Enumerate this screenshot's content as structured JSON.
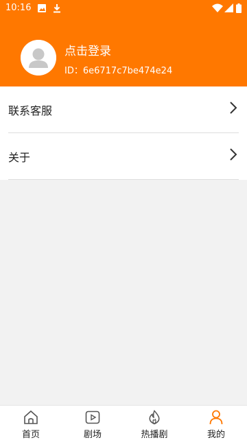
{
  "status_bar": {
    "time": "10:16",
    "icons": [
      "image-icon",
      "download-icon",
      "wifi-icon",
      "signal-icon",
      "battery-icon"
    ]
  },
  "profile": {
    "login_text": "点击登录",
    "user_id": "ID：6e6717c7be474e24",
    "avatar_icon": "user-avatar-icon"
  },
  "menu": {
    "items": [
      {
        "label": "联系客服",
        "icon": "chevron-right-icon"
      },
      {
        "label": "关于",
        "icon": "chevron-right-icon"
      }
    ]
  },
  "tabbar": {
    "tabs": [
      {
        "label": "首页",
        "icon": "home-icon",
        "active": false
      },
      {
        "label": "剧场",
        "icon": "play-icon",
        "active": false
      },
      {
        "label": "热播剧",
        "icon": "flame-icon",
        "active": false
      },
      {
        "label": "我的",
        "icon": "person-icon",
        "active": true
      }
    ]
  },
  "colors": {
    "brand": "#ff7800",
    "active_tab_icon": "#ff7800",
    "background": "#f2f2f2"
  }
}
